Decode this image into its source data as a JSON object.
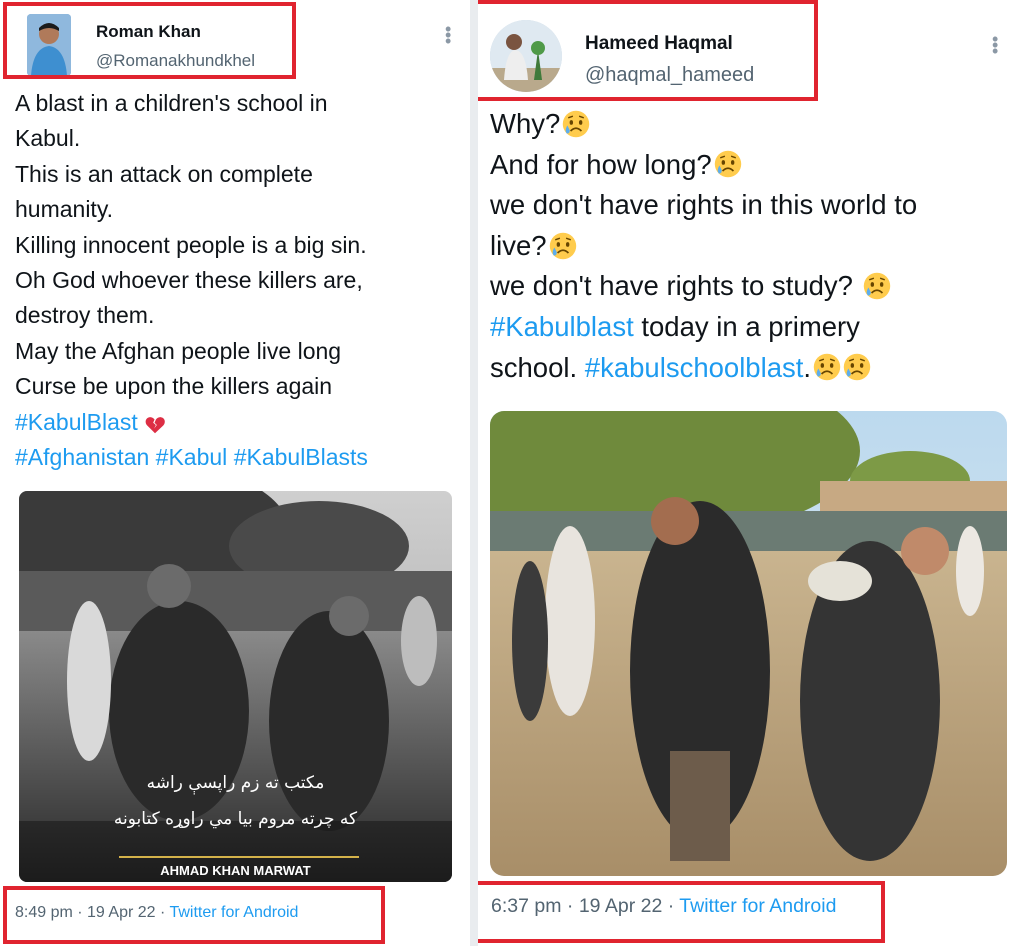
{
  "tweets": [
    {
      "name": "Roman Khan",
      "handle": "@Romanakhundkhel",
      "lines": [
        "A blast in a children's school in",
        "Kabul.",
        "This is an attack on complete",
        "humanity.",
        "Killing innocent people is a big sin.",
        "Oh God whoever these killers are,",
        "destroy them.",
        "May the Afghan people live long",
        "Curse be upon the killers again"
      ],
      "hashtag_line1": "#KabulBlast",
      "hashtags_line2": [
        "#Afghanistan",
        "#Kabul",
        "#KabulBlasts"
      ],
      "image_caption_line1": "مکتب ته زم راپسې راشه",
      "image_caption_line2": "که چرته مروم بیا مي راوړه کتابونه",
      "image_credit": "AHMAD KHAN MARWAT",
      "time": "8:49 pm",
      "date": "19 Apr 22",
      "source": "Twitter for Android"
    },
    {
      "name": "Hameed Haqmal",
      "handle": "@haqmal_hameed",
      "line1": "Why?",
      "line2": "And for how long?",
      "line3": "we don't have rights in this world to",
      "line4": "live?",
      "line5": "we don't have rights to study?",
      "line6_hashtag": "#Kabulblast",
      "line6_rest": " today in a primery",
      "line7_text": "school. ",
      "line7_hashtag": "#kabulschoolblast",
      "line7_end": ".",
      "time": "6:37 pm",
      "date": "19 Apr 22",
      "source": "Twitter for Android"
    }
  ],
  "separator": " · ",
  "colors": {
    "highlight_box": "#e0242f",
    "link": "#1d9bf0",
    "muted": "#536471"
  },
  "icons": [
    "more-options-icon",
    "broken-heart-emoji",
    "sad-tear-emoji"
  ]
}
